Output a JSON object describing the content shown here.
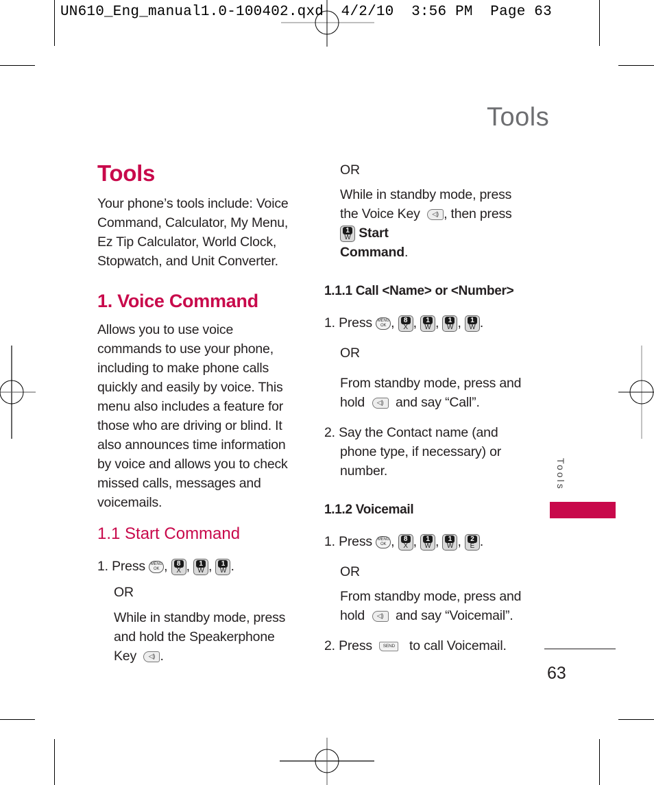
{
  "slug_line": "UN610_Eng_manual1.0-100402.qxd  4/2/10  3:56 PM  Page 63",
  "running_head": "Tools",
  "side_tab_label": "Tools",
  "page_number": "63",
  "accent_color": "#c8094b",
  "left_column": {
    "title": "Tools",
    "intro_lines": [
      "Your phone’s tools include: Voice",
      "Command, Calculator, My Menu,",
      "Ez Tip Calculator, World Clock,",
      "Stopwatch, and Unit Converter."
    ],
    "section_title": "1. Voice Command",
    "section_lines": [
      "Allows you to use voice",
      "commands to use your phone,",
      "including to make phone calls",
      "quickly and easily by voice. This",
      "menu also includes a feature for",
      "those who are driving or blind. It",
      "also announces time information",
      "by voice and allows you to check",
      "missed calls, messages and",
      "voicemails."
    ],
    "subsection_title": "1.1 Start Command",
    "step1_prefix": "1. Press",
    "or_label": "OR",
    "alt_lines": [
      "While in standby mode, press",
      "and hold the Speakerphone",
      "Key"
    ]
  },
  "right_column": {
    "or_label": "OR",
    "voice_key_line1": "While in standby mode, press",
    "voice_key_line2_a": "the Voice Key",
    "voice_key_line2_b": ", then press",
    "start_label": "Start",
    "command_label": "Command",
    "call_heading": "1.1.1 Call <Name> or <Number>",
    "call_step1_prefix": "1. Press",
    "call_or": "OR",
    "call_alt_line1": "From standby mode, press and",
    "call_alt_line2_a": "hold",
    "call_alt_line2_b": "and say “Call”.",
    "call_step2_lines": [
      "2. Say the Contact name (and",
      "phone type, if necessary) or",
      "number."
    ],
    "vm_heading": "1.1.2 Voicemail",
    "vm_step1_prefix": "1. Press",
    "vm_or": "OR",
    "vm_alt_line1": "From standby mode, press and",
    "vm_alt_line2_a": "hold",
    "vm_alt_line2_b": "and say “Voicemail”.",
    "vm_step2_a": "2. Press",
    "vm_step2_b": "to call Voicemail."
  },
  "keys": {
    "menu_top": "MENU",
    "menu_bottom": "OK",
    "k8_num": "8",
    "k8_letter": "X",
    "k1_num": "1",
    "k1_letter": "W",
    "k2_num": "2",
    "k2_letter": "E",
    "speaker_glyph": "◁)",
    "send_label": "SEND"
  }
}
